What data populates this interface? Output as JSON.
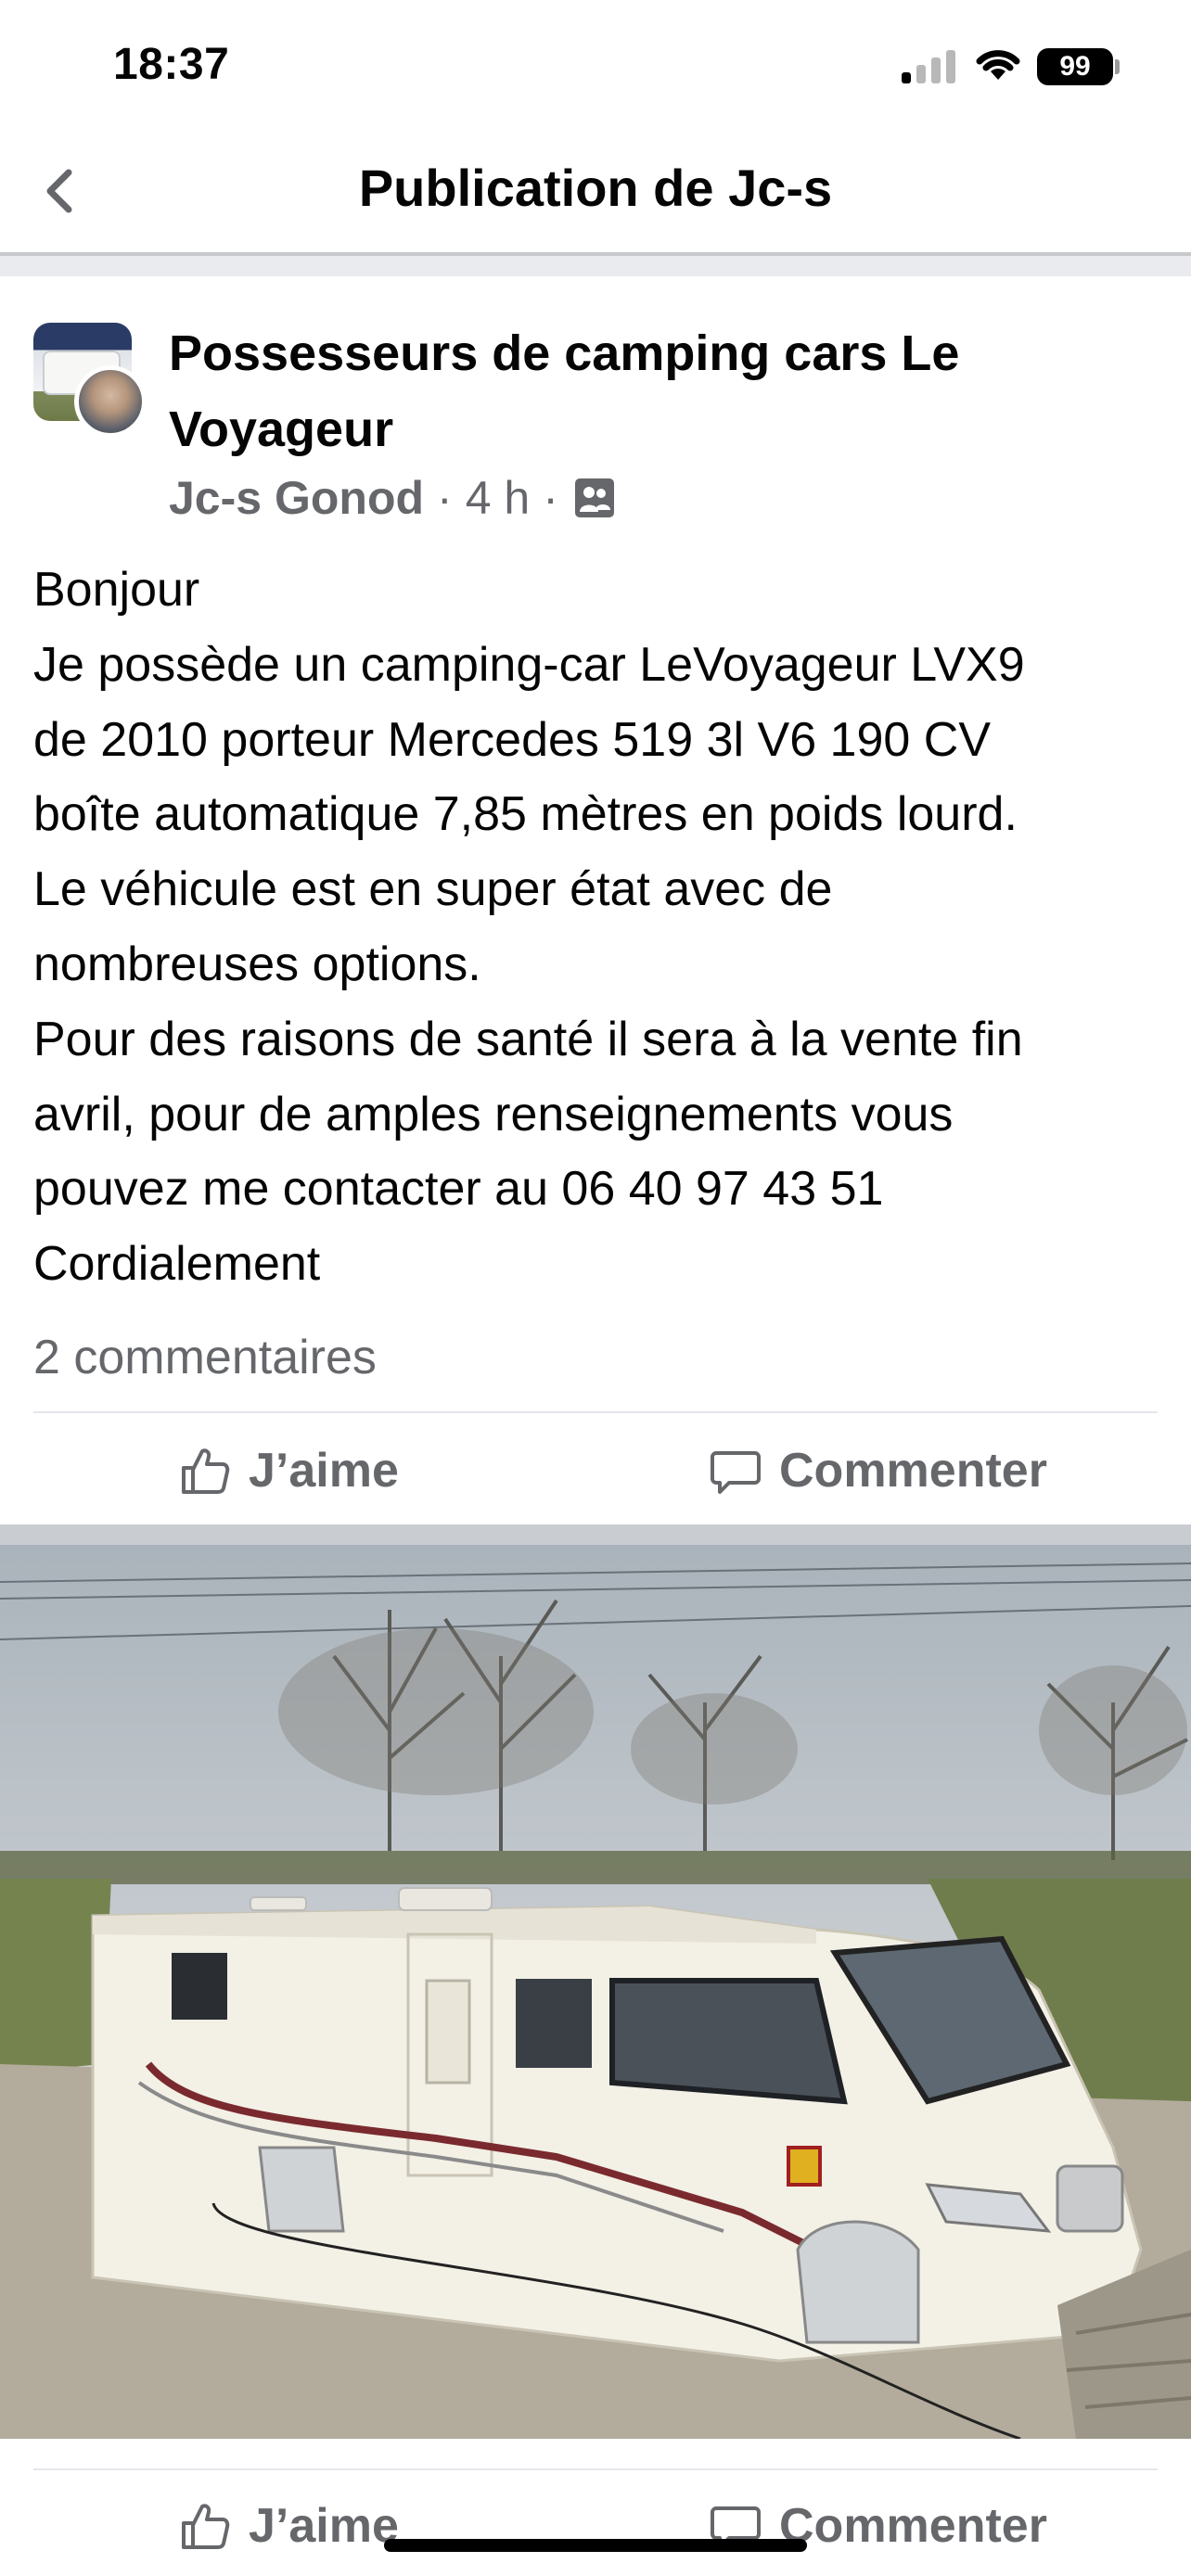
{
  "status_bar": {
    "time": "18:37",
    "battery": "99"
  },
  "nav": {
    "title": "Publication de Jc-s"
  },
  "post": {
    "group_name": "Possesseurs de camping cars Le Voyageur",
    "author": "Jc-s Gonod",
    "dot1": "·",
    "time_ago": "4 h",
    "dot2": "·",
    "audience_icon": "group-icon",
    "lines": [
      "Bonjour",
      "Je possède un camping-car LeVoyageur LVX9",
      "de 2010 porteur Mercedes 519 3l V6 190 CV",
      "boîte automatique 7,85 mètres en poids lourd.",
      "Le véhicule est en super état avec de",
      "nombreuses options.",
      "Pour des raisons de santé il sera à la vente fin",
      "avril, pour de amples renseignements vous",
      "pouvez me contacter au 06 40 97 43 51",
      "Cordialement"
    ],
    "comments_count": "2 commentaires",
    "like_label": "J’aime",
    "comment_label": "Commenter"
  },
  "photo_section": {
    "like_label": "J’aime",
    "comment_label": "Commenter"
  },
  "colors": {
    "text_primary": "#050505",
    "text_secondary": "#65676b",
    "separator": "#cdd0d4"
  }
}
